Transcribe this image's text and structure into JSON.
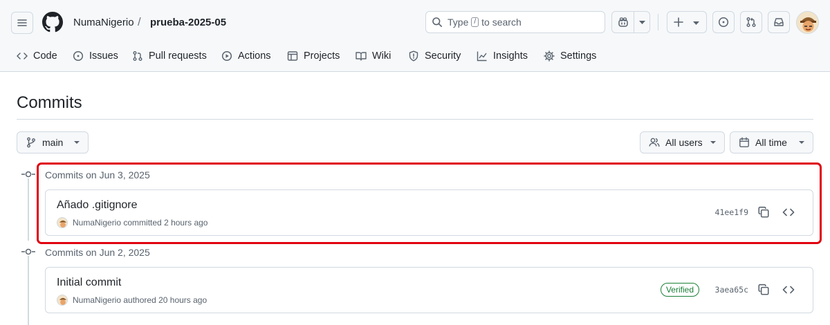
{
  "header": {
    "owner": "NumaNigerio",
    "separator": "/",
    "repo": "prueba-2025-05",
    "search": {
      "prefix": "Type",
      "key": "/",
      "suffix": "to search"
    }
  },
  "nav": {
    "items": [
      {
        "label": "Code",
        "icon": "code-icon"
      },
      {
        "label": "Issues",
        "icon": "issue-icon"
      },
      {
        "label": "Pull requests",
        "icon": "pull-request-icon"
      },
      {
        "label": "Actions",
        "icon": "play-icon"
      },
      {
        "label": "Projects",
        "icon": "table-icon"
      },
      {
        "label": "Wiki",
        "icon": "book-icon"
      },
      {
        "label": "Security",
        "icon": "shield-icon"
      },
      {
        "label": "Insights",
        "icon": "graph-icon"
      },
      {
        "label": "Settings",
        "icon": "gear-icon"
      }
    ]
  },
  "page": {
    "title": "Commits",
    "branch": "main",
    "users_filter": "All users",
    "time_filter": "All time"
  },
  "groups": [
    {
      "heading": "Commits on Jun 3, 2025",
      "commits": [
        {
          "title": "Añado .gitignore",
          "author": "NumaNigerio",
          "action": "committed",
          "time": "2 hours ago",
          "sha": "41ee1f9",
          "verified": ""
        }
      ]
    },
    {
      "heading": "Commits on Jun 2, 2025",
      "commits": [
        {
          "title": "Initial commit",
          "author": "NumaNigerio",
          "action": "authored",
          "time": "20 hours ago",
          "sha": "3aea65c",
          "verified": "Verified"
        }
      ]
    }
  ],
  "colors": {
    "highlight": "#e0000f",
    "verified": "#1a7f37",
    "muted": "#59636e",
    "border": "#d1d9e0"
  }
}
